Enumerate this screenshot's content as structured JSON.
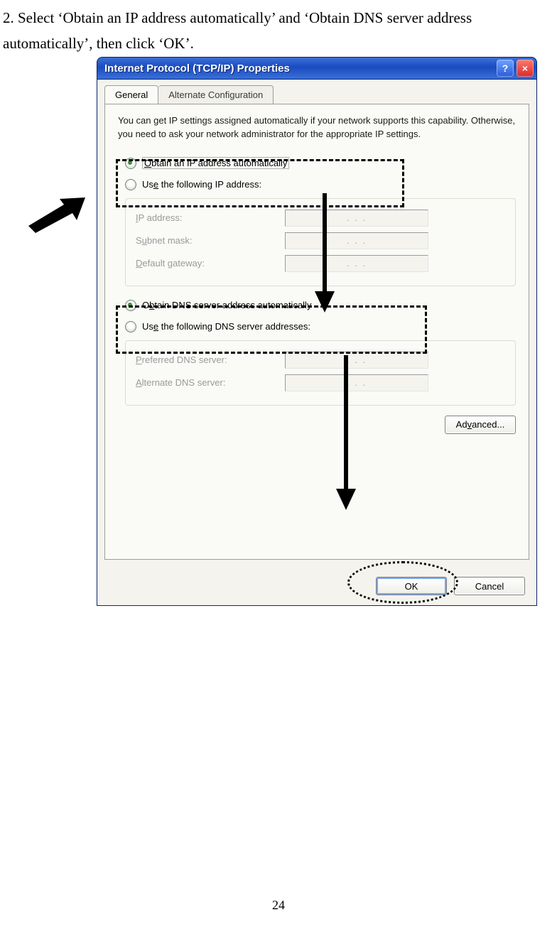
{
  "instruction": "2. Select ‘Obtain an IP address automatically’ and ‘Obtain DNS server address automatically’, then click ‘OK’.",
  "page_number": "24",
  "dialog": {
    "title": "Internet Protocol (TCP/IP) Properties",
    "help_tooltip": "?",
    "close_tooltip": "×",
    "tabs": {
      "general": "General",
      "alternate": "Alternate Configuration"
    },
    "description": "You can get IP settings assigned automatically if your network supports this capability. Otherwise, you need to ask your network administrator for the appropriate IP settings.",
    "ip_group": {
      "obtain_auto_prefix": "O",
      "obtain_auto_rest": "btain an IP address automatically",
      "use_following_prefix": "Us",
      "use_following_rest": "e the following IP address:",
      "ip_address_label_prefix": "I",
      "ip_address_label_rest": "P address:",
      "subnet_label_prefix": "S",
      "subnet_label_rest": "ubnet mask:",
      "gateway_label_prefix": "D",
      "gateway_label_rest": "efault gateway:",
      "dots": ".       .       ."
    },
    "dns_group": {
      "obtain_auto_prefix": "O",
      "obtain_auto_rest": "btain DNS server address automatically",
      "use_following_prefix": "Us",
      "use_following_rest": "e the following DNS server addresses:",
      "preferred_prefix": "P",
      "preferred_rest": "referred DNS server:",
      "alternate_prefix": "A",
      "alternate_rest": "lternate DNS server:",
      "dots": ".       .       ."
    },
    "advanced_label_prefix": "Ad",
    "advanced_label_rest": "vanced...",
    "ok_label": "OK",
    "cancel_label": "Cancel"
  }
}
